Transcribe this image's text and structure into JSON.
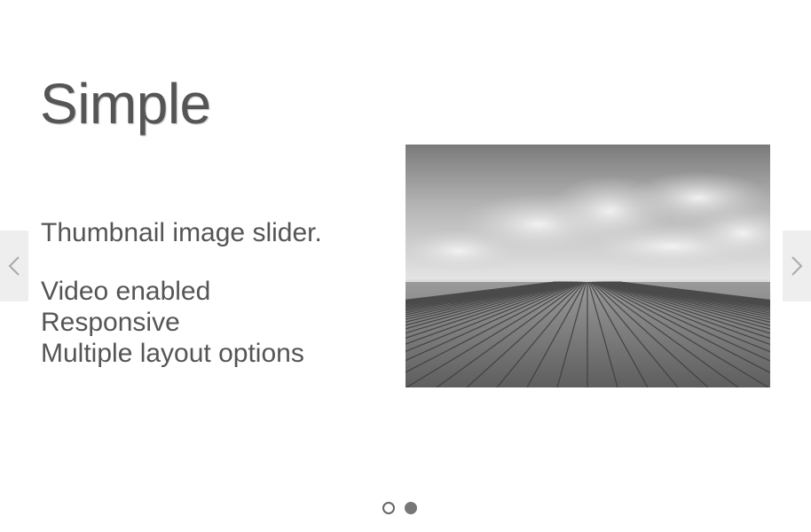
{
  "slide": {
    "title": "Simple",
    "subtitle": "Thumbnail image slider.",
    "features": [
      "Video enabled",
      "Responsive",
      "Multiple layout options"
    ],
    "image": "cloudy sky over wooden boardwalk, grayscale"
  },
  "navigation": {
    "prev_icon": "chevron-left-icon",
    "next_icon": "chevron-right-icon"
  },
  "pager": {
    "total": 2,
    "active_index": 2
  },
  "colors": {
    "text": "#555555",
    "arrow_bg": "#eeeeee",
    "dot": "#777777"
  }
}
